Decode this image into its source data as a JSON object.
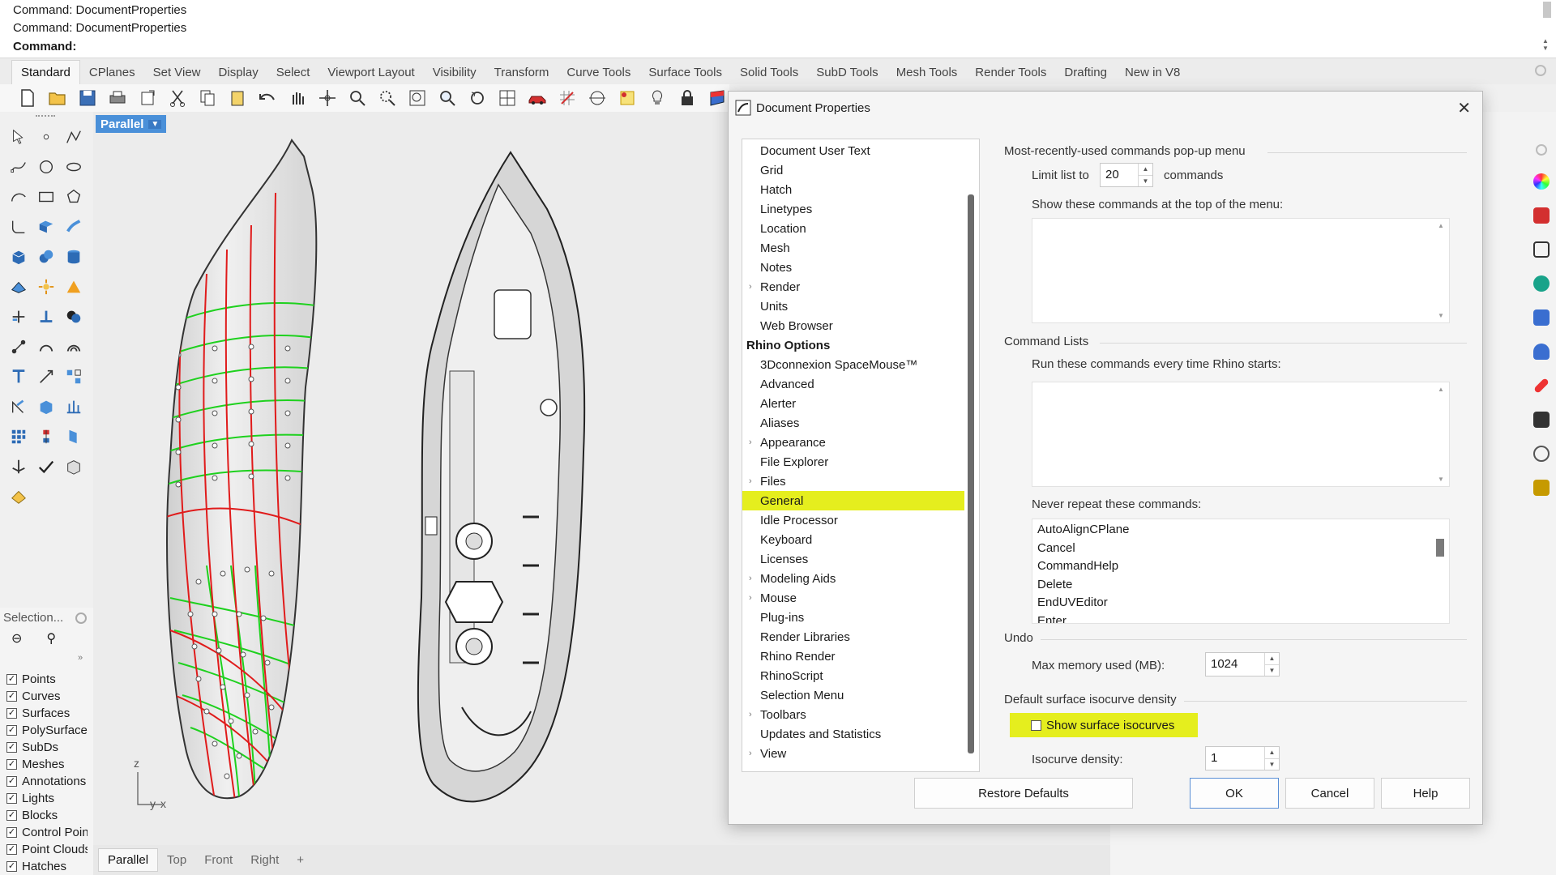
{
  "command": {
    "history": [
      "Command: DocumentProperties",
      "Command: DocumentProperties"
    ],
    "prompt": "Command:"
  },
  "tabs": [
    "Standard",
    "CPlanes",
    "Set View",
    "Display",
    "Select",
    "Viewport Layout",
    "Visibility",
    "Transform",
    "Curve Tools",
    "Surface Tools",
    "Solid Tools",
    "SubD Tools",
    "Mesh Tools",
    "Render Tools",
    "Drafting",
    "New in V8"
  ],
  "viewport": {
    "label": "Parallel",
    "axis_z": "z",
    "axis_y": "y",
    "axis_x": "x",
    "tabs": [
      "Parallel",
      "Top",
      "Front",
      "Right"
    ],
    "add_tab": "+"
  },
  "selection": {
    "title": "Selection...",
    "items": [
      "Points",
      "Curves",
      "Surfaces",
      "PolySurfaces",
      "SubDs",
      "Meshes",
      "Annotations",
      "Lights",
      "Blocks",
      "Control Points",
      "Point Clouds",
      "Hatches"
    ]
  },
  "dialog": {
    "title": "Document Properties",
    "close": "✕",
    "tree": [
      {
        "label": "Document User Text",
        "type": "item"
      },
      {
        "label": "Grid",
        "type": "item"
      },
      {
        "label": "Hatch",
        "type": "item"
      },
      {
        "label": "Linetypes",
        "type": "item"
      },
      {
        "label": "Location",
        "type": "item"
      },
      {
        "label": "Mesh",
        "type": "item"
      },
      {
        "label": "Notes",
        "type": "item"
      },
      {
        "label": "Render",
        "type": "expandable"
      },
      {
        "label": "Units",
        "type": "item"
      },
      {
        "label": "Web Browser",
        "type": "item"
      },
      {
        "label": "Rhino Options",
        "type": "header"
      },
      {
        "label": "3Dconnexion SpaceMouse™",
        "type": "item"
      },
      {
        "label": "Advanced",
        "type": "item"
      },
      {
        "label": "Alerter",
        "type": "item"
      },
      {
        "label": "Aliases",
        "type": "item"
      },
      {
        "label": "Appearance",
        "type": "expandable"
      },
      {
        "label": "File Explorer",
        "type": "item"
      },
      {
        "label": "Files",
        "type": "expandable"
      },
      {
        "label": "General",
        "type": "selected"
      },
      {
        "label": "Idle Processor",
        "type": "item"
      },
      {
        "label": "Keyboard",
        "type": "item"
      },
      {
        "label": "Licenses",
        "type": "item"
      },
      {
        "label": "Modeling Aids",
        "type": "expandable"
      },
      {
        "label": "Mouse",
        "type": "expandable"
      },
      {
        "label": "Plug-ins",
        "type": "item"
      },
      {
        "label": "Render Libraries",
        "type": "item"
      },
      {
        "label": "Rhino Render",
        "type": "item"
      },
      {
        "label": "RhinoScript",
        "type": "item"
      },
      {
        "label": "Selection Menu",
        "type": "item"
      },
      {
        "label": "Toolbars",
        "type": "expandable"
      },
      {
        "label": "Updates and Statistics",
        "type": "item"
      },
      {
        "label": "View",
        "type": "expandable"
      }
    ],
    "mru": {
      "title": "Most-recently-used commands pop-up menu",
      "limit_label": "Limit list to",
      "limit_value": "20",
      "limit_suffix": "commands",
      "top_label": "Show these commands at the top of the menu:"
    },
    "cmdlists": {
      "title": "Command Lists",
      "run_label": "Run these commands every time Rhino starts:",
      "never_label": "Never repeat these commands:",
      "never_items": [
        "AutoAlignCPlane",
        "Cancel",
        "CommandHelp",
        "Delete",
        "EndUVEditor",
        "Enter"
      ]
    },
    "undo": {
      "title": "Undo",
      "mem_label": "Max memory used (MB):",
      "mem_value": "1024"
    },
    "isocurve": {
      "title": "Default surface isocurve density",
      "show_label": "Show surface isocurves",
      "density_label": "Isocurve density:",
      "density_value": "1"
    },
    "buttons": {
      "restore": "Restore Defaults",
      "ok": "OK",
      "cancel": "Cancel",
      "help": "Help"
    }
  },
  "colors": {
    "highlight": "#e5ee1e",
    "viewport_label": "#4a90d9",
    "curve_red": "#e01b1b",
    "curve_green": "#1ed11e"
  }
}
